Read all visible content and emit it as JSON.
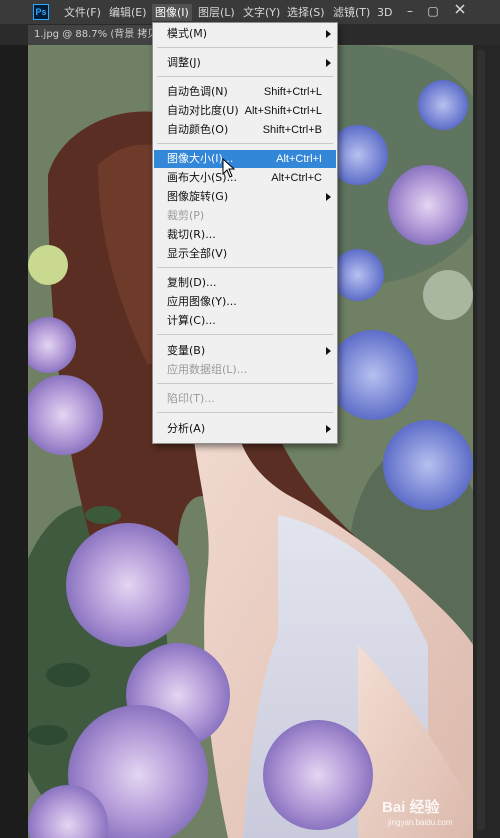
{
  "app": {
    "logo_text": "Ps",
    "menus": [
      {
        "label": "文件(F)"
      },
      {
        "label": "编辑(E)"
      },
      {
        "label": "图像(I)"
      },
      {
        "label": "图层(L)"
      },
      {
        "label": "文字(Y)"
      },
      {
        "label": "选择(S)"
      },
      {
        "label": "滤镜(T)"
      },
      {
        "label": "3D"
      }
    ],
    "window_buttons": {
      "minimize": "–",
      "restore": "▢"
    }
  },
  "document": {
    "tab_title": "1.jpg @ 88.7% (背景 拷贝"
  },
  "image_menu": {
    "items": [
      {
        "label": "模式(M)",
        "submenu": true
      },
      {
        "label": "调整(J)",
        "submenu": true
      },
      {
        "label": "自动色调(N)",
        "shortcut": "Shift+Ctrl+L"
      },
      {
        "label": "自动对比度(U)",
        "shortcut": "Alt+Shift+Ctrl+L"
      },
      {
        "label": "自动颜色(O)",
        "shortcut": "Shift+Ctrl+B"
      },
      {
        "label": "图像大小(I)...",
        "shortcut": "Alt+Ctrl+I",
        "highlighted": true
      },
      {
        "label": "画布大小(S)...",
        "shortcut": "Alt+Ctrl+C"
      },
      {
        "label": "图像旋转(G)",
        "submenu": true
      },
      {
        "label": "裁剪(P)",
        "disabled": true
      },
      {
        "label": "裁切(R)..."
      },
      {
        "label": "显示全部(V)"
      },
      {
        "label": "复制(D)..."
      },
      {
        "label": "应用图像(Y)..."
      },
      {
        "label": "计算(C)..."
      },
      {
        "label": "变量(B)",
        "submenu": true
      },
      {
        "label": "应用数据组(L)...",
        "disabled": true
      },
      {
        "label": "陷印(T)...",
        "disabled": true
      },
      {
        "label": "分析(A)",
        "submenu": true
      }
    ]
  },
  "watermark": {
    "main": "Bai 经验",
    "sub": "jingyan.baidu.com"
  }
}
